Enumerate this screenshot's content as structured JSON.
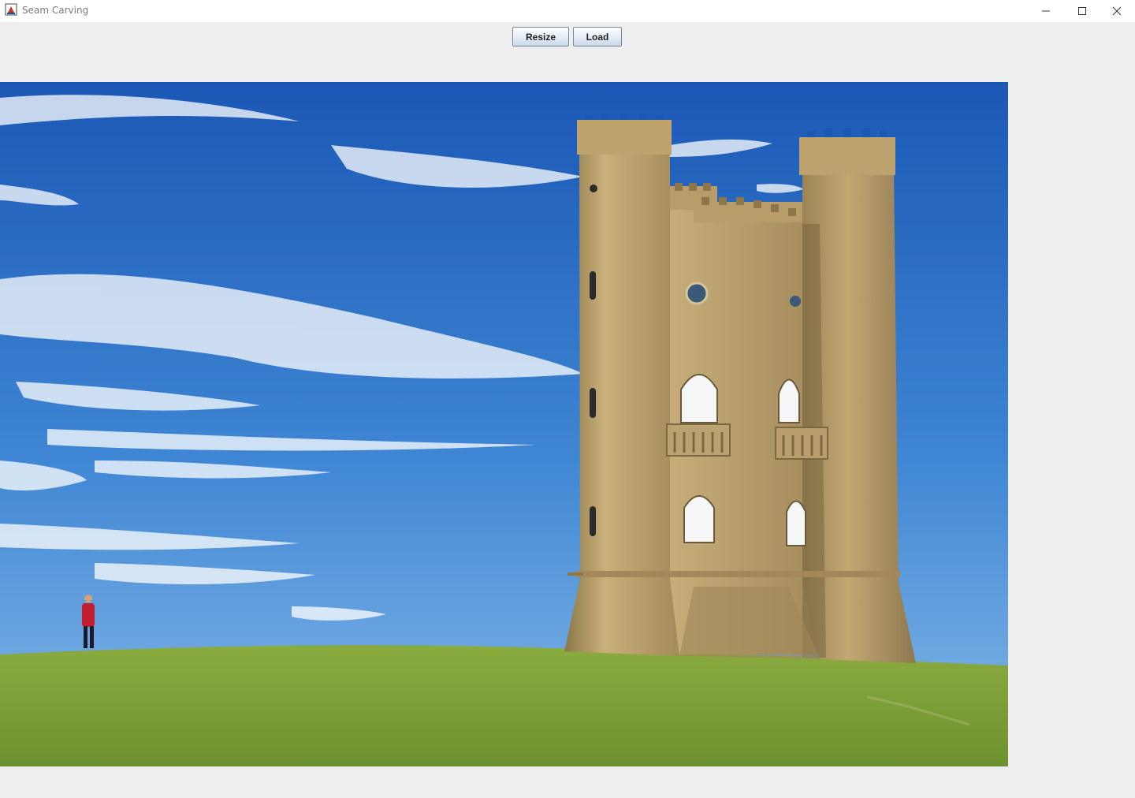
{
  "window": {
    "title": "Seam Carving",
    "app_icon": "java-cup-icon",
    "controls": [
      "minimize-icon",
      "maximize-icon",
      "close-icon"
    ]
  },
  "toolbar": {
    "resize_label": "Resize",
    "load_label": "Load"
  },
  "image": {
    "description_icon": "landscape-photo",
    "colors": {
      "sky_top": "#1e5db8",
      "sky_bottom": "#7fb4e6",
      "grass": "#7fa338",
      "stone": "#b39a68"
    }
  }
}
